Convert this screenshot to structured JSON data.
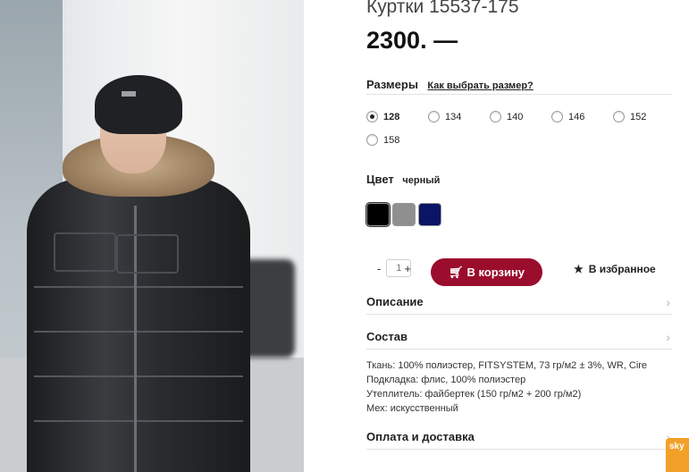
{
  "product": {
    "title": "Куртки 15537-175",
    "price": "2300. —"
  },
  "sizes": {
    "label": "Размеры",
    "guide_link": "Как выбрать размер?",
    "options": [
      "128",
      "134",
      "140",
      "146",
      "152",
      "158"
    ],
    "selected": "128"
  },
  "color": {
    "label": "Цвет",
    "selected_name": "черный",
    "swatches": [
      "#000000",
      "#8f8f8f",
      "#0b1565"
    ]
  },
  "quantity": {
    "minus": "-",
    "value": "1",
    "plus": "+"
  },
  "actions": {
    "add_to_cart": "В корзину",
    "favorite": "В избранное"
  },
  "sections": {
    "description": "Описание",
    "composition": "Состав",
    "payment": "Оплата и доставка"
  },
  "composition_lines": [
    "Ткань: 100% полиэстер, FITSYSTEM, 73 гр/м2 ± 3%, WR, Cire",
    "Подкладка: флис, 100% полиэстер",
    "Утеплитель: файбертек (150 гр/м2 + 200 гр/м2)",
    "Мех: искусственный"
  ],
  "skype": {
    "label": "sky"
  },
  "colors": {
    "accent": "#9b0d2c"
  }
}
